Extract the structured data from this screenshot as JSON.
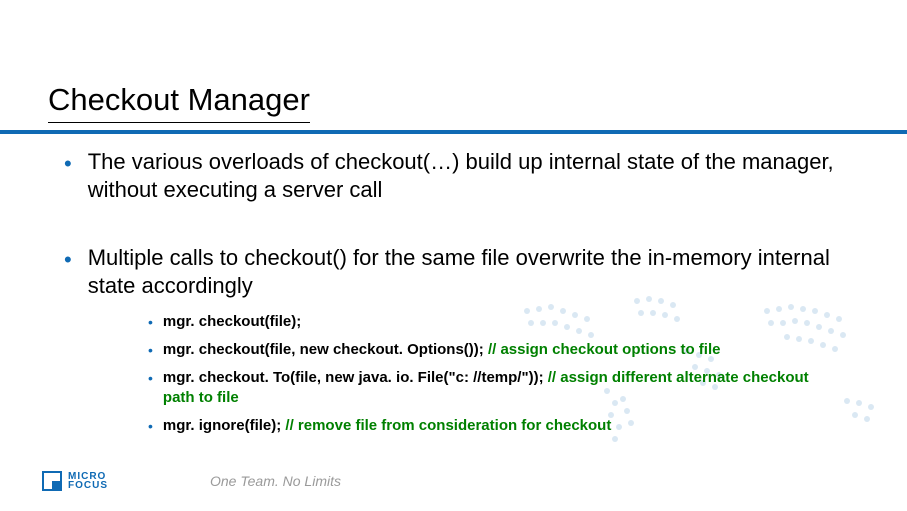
{
  "title": "Checkout Manager",
  "bullets": [
    {
      "text": "The various overloads of checkout(…) build up internal state of the manager, without executing a server call"
    },
    {
      "text": "Multiple calls to checkout() for the same file overwrite the in-memory internal state accordingly",
      "sub": [
        {
          "code": "mgr. checkout(file);",
          "comment": ""
        },
        {
          "code": "mgr. checkout(file, new checkout. Options());",
          "comment": "  // assign checkout options to file"
        },
        {
          "code": "mgr. checkout. To(file, new java. io. File(\"c: //temp/\"));",
          "comment": "  // assign different alternate checkout path to file"
        },
        {
          "code": "mgr. ignore(file);",
          "comment": "  // remove file from consideration for checkout"
        }
      ]
    }
  ],
  "footer": {
    "brand_top": "MICRO",
    "brand_bottom": "FOCUS",
    "tagline": "One Team. No Limits"
  }
}
